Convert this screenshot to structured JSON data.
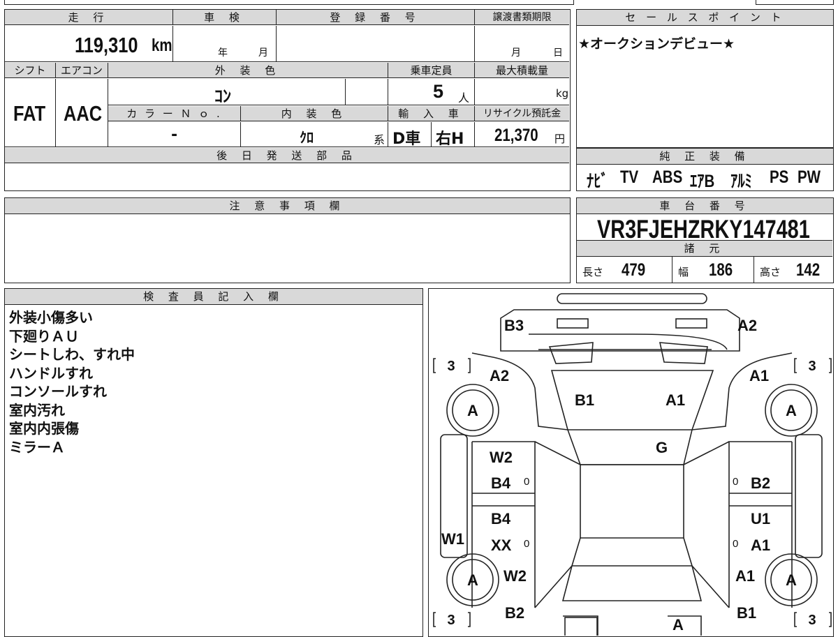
{
  "top": {
    "mileage_label": "走 行",
    "mileage": "119,310",
    "mileage_unit": "km",
    "inspection_label": "車 検",
    "inspection_year": "年",
    "inspection_month": "月",
    "reg_label": "登 録 番 号",
    "reg_value": "",
    "transfer_label": "譲渡書類期限",
    "transfer_month": "月",
    "transfer_day": "日",
    "shift_label": "シフト",
    "shift": "FAT",
    "ac_label": "エアコン",
    "ac": "AAC",
    "ext_color_label": "外 装 色",
    "ext_color": "ｺﾝ",
    "capacity_label": "乗車定員",
    "capacity": "5",
    "capacity_unit": "人",
    "maxload_label": "最大積載量",
    "maxload_unit": "kg",
    "colorno_label": "カ ラ ー Ｎ ｏ .",
    "colorno": "-",
    "int_color_label": "内 装 色",
    "int_color": "ｸﾛ",
    "int_suffix": "系",
    "import_label": "輸 入 車",
    "import_value": "D車",
    "handle": "右H",
    "recycle_label": "リサイクル預託金",
    "recycle": "21,370",
    "recycle_unit": "円",
    "later_label": "後 日 発 送 部 品"
  },
  "sales": {
    "label": "セ ー ル ス ポ イ ン ト",
    "text": "★オークションデビュー★"
  },
  "genuine": {
    "label": "純 正 装 備",
    "items": [
      "ﾅﾋﾞ",
      "TV",
      "ABS",
      "ｴｱB",
      "ｱﾙﾐ",
      "PS",
      "PW"
    ]
  },
  "notes": {
    "label": "注 意 事 項 欄"
  },
  "chassis": {
    "label": "車 台 番 号",
    "number": "VR3FJEHZRKY147481",
    "spec_label": "諸 元",
    "length_label": "長さ",
    "length": "479",
    "width_label": "幅",
    "width": "186",
    "height_label": "高さ",
    "height": "142"
  },
  "inspector": {
    "label": "検 査 員 記 入 欄",
    "lines": [
      "外装小傷多い",
      "下廻りＡＵ",
      "シートしわ、すれ中",
      "ハンドルすれ",
      "コンソールすれ",
      "室内汚れ",
      "室内内張傷",
      "ミラーＡ"
    ]
  },
  "diagram": {
    "b3": "B3",
    "a2_top": "A2",
    "a2_left": "A2",
    "a1_right": "A1",
    "b1_hood": "B1",
    "a1_hood": "A1",
    "g": "G",
    "w2_front_left": "W2",
    "b4_front_left": "B4",
    "b2_front_right": "B2",
    "b4_rear_left": "B4",
    "xx_rear_left": "XX",
    "u1_rear_right": "U1",
    "a1_rear_right": "A1",
    "w1": "W1",
    "w2_bottom_left": "W2",
    "a1_bottom_right": "A1",
    "b2_bottom_left": "B2",
    "b1_bottom_right": "B1",
    "a_bottom": "A",
    "tire": "A",
    "tread": "3",
    "zero": "0"
  }
}
